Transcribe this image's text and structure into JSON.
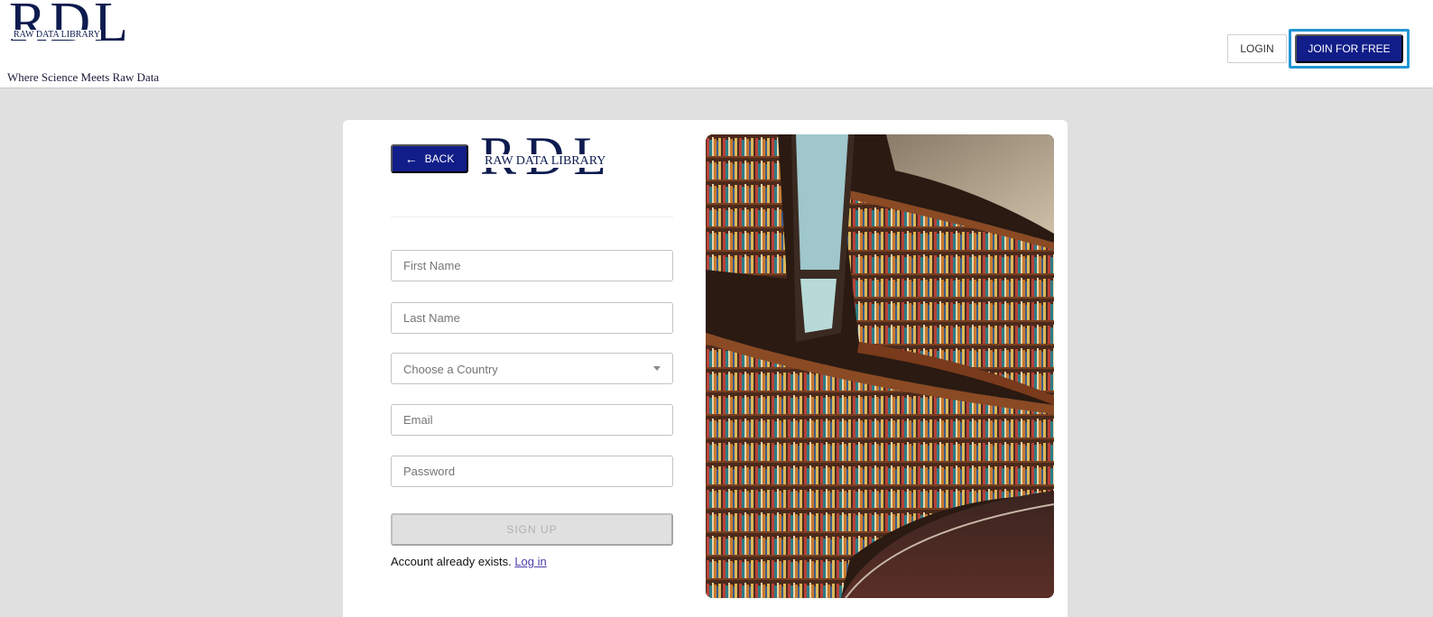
{
  "header": {
    "logo_letters": "RDL",
    "logo_subtitle": "RAW DATA LIBRARY",
    "tagline": "Where Science Meets Raw Data",
    "login_label": "LOGIN",
    "join_label": "JOIN FOR FREE"
  },
  "card": {
    "back_label": "BACK",
    "logo_letters": "RDL",
    "logo_subtitle": "RAW DATA LIBRARY",
    "form": {
      "first_name_placeholder": "First Name",
      "last_name_placeholder": "Last Name",
      "country_label": "Choose a Country",
      "email_placeholder": "Email",
      "password_placeholder": "Password",
      "signup_label": "SIGN UP",
      "account_text": "Account already exists.",
      "login_link": "Log in"
    }
  },
  "colors": {
    "primary": "#111d88",
    "focus_ring": "#2196d4",
    "page_background": "#e0e0e0",
    "link": "#4b3fa8"
  },
  "icons": {
    "back": "arrow-left-icon",
    "select": "caret-down-icon"
  }
}
